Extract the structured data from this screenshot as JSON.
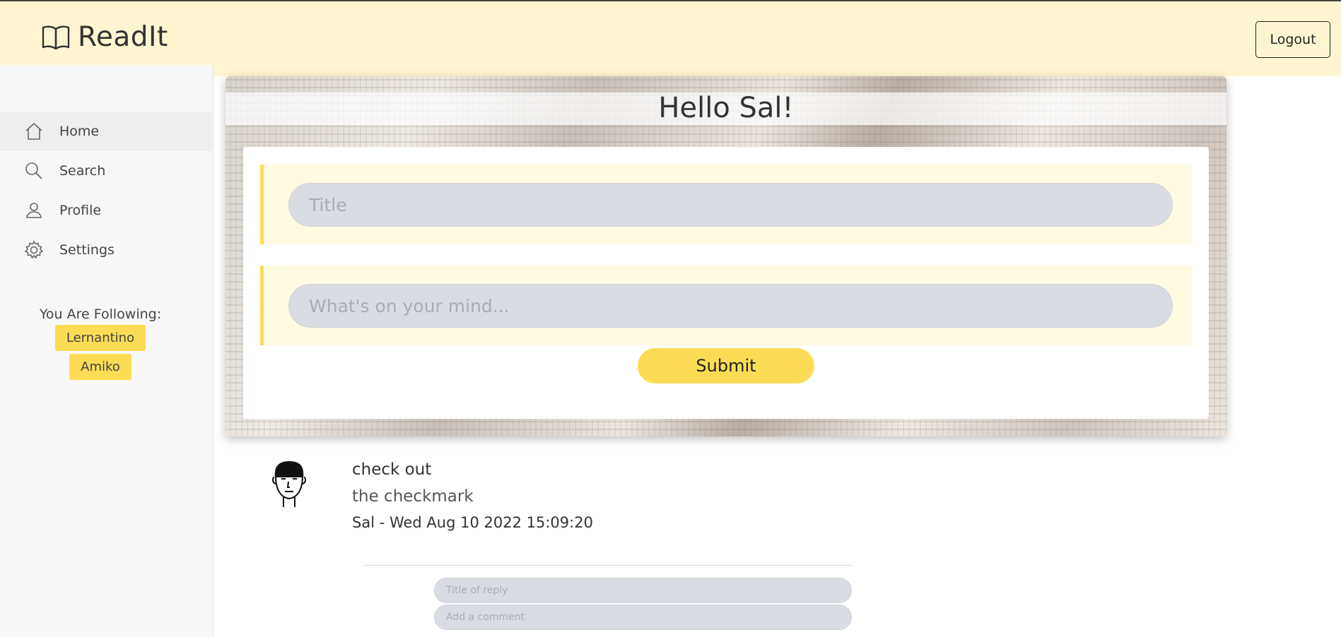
{
  "header": {
    "brand": "ReadIt",
    "brand_icon": "book-icon",
    "logout_label": "Logout"
  },
  "sidebar": {
    "items": [
      {
        "label": "Home",
        "icon": "home-icon",
        "active": true
      },
      {
        "label": "Search",
        "icon": "search-icon"
      },
      {
        "label": "Profile",
        "icon": "user-icon"
      },
      {
        "label": "Settings",
        "icon": "gear-icon"
      }
    ],
    "following_title": "You Are Following:",
    "following": [
      "Lernantino",
      "Amiko"
    ]
  },
  "composer": {
    "greeting": "Hello Sal!",
    "title_placeholder": "Title",
    "body_placeholder": "What's on your mind...",
    "submit_label": "Submit"
  },
  "post": {
    "title": "check out",
    "body": "the checkmark",
    "meta": "Sal - Wed Aug 10 2022 15:09:20",
    "avatar_icon": "avatar-face-icon",
    "reply_title_placeholder": "Title of reply",
    "reply_comment_placeholder": "Add a comment"
  },
  "colors": {
    "header_bg": "#fff6d1",
    "accent": "#fddc55",
    "input_bg": "#d9dce3",
    "sidebar_bg": "#f8f8f8"
  }
}
